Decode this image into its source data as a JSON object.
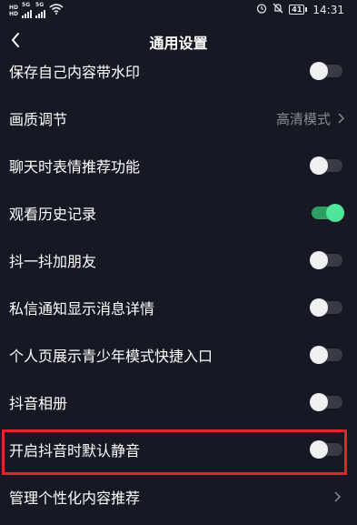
{
  "status_bar": {
    "hd1": "HD",
    "hd1_sub": "1",
    "hd2": "HD",
    "hd2_sub": "2",
    "net1": "5G",
    "net2": "5G",
    "battery": "41",
    "time": "14:31",
    "icons": [
      "hd-icon",
      "signal-icon",
      "signal-icon",
      "wifi-icon",
      "alarm-icon",
      "mute-bell-icon",
      "battery-icon"
    ]
  },
  "nav": {
    "title": "通用设置",
    "back_icon": "chevron-left-icon"
  },
  "settings": [
    {
      "label": "保存自己内容带水印",
      "type": "toggle",
      "on": false
    },
    {
      "label": "画质调节",
      "type": "select",
      "value": "高清模式"
    },
    {
      "label": "聊天时表情推荐功能",
      "type": "toggle",
      "on": false
    },
    {
      "label": "观看历史记录",
      "type": "toggle",
      "on": true
    },
    {
      "label": "抖一抖加朋友",
      "type": "toggle",
      "on": false
    },
    {
      "label": "私信通知显示消息详情",
      "type": "toggle",
      "on": false
    },
    {
      "label": "个人页展示青少年模式快捷入口",
      "type": "toggle",
      "on": false
    },
    {
      "label": "抖音相册",
      "type": "toggle",
      "on": false
    },
    {
      "label": "开启抖音时默认静音",
      "type": "toggle",
      "on": false,
      "highlighted": true
    },
    {
      "label": "管理个性化内容推荐",
      "type": "link"
    }
  ],
  "colors": {
    "background": "#161823",
    "toggle_on": "#4fe59a",
    "toggle_off_track": "#3a3b45",
    "highlight": "#e0262b",
    "secondary_text": "#8a8b91"
  }
}
